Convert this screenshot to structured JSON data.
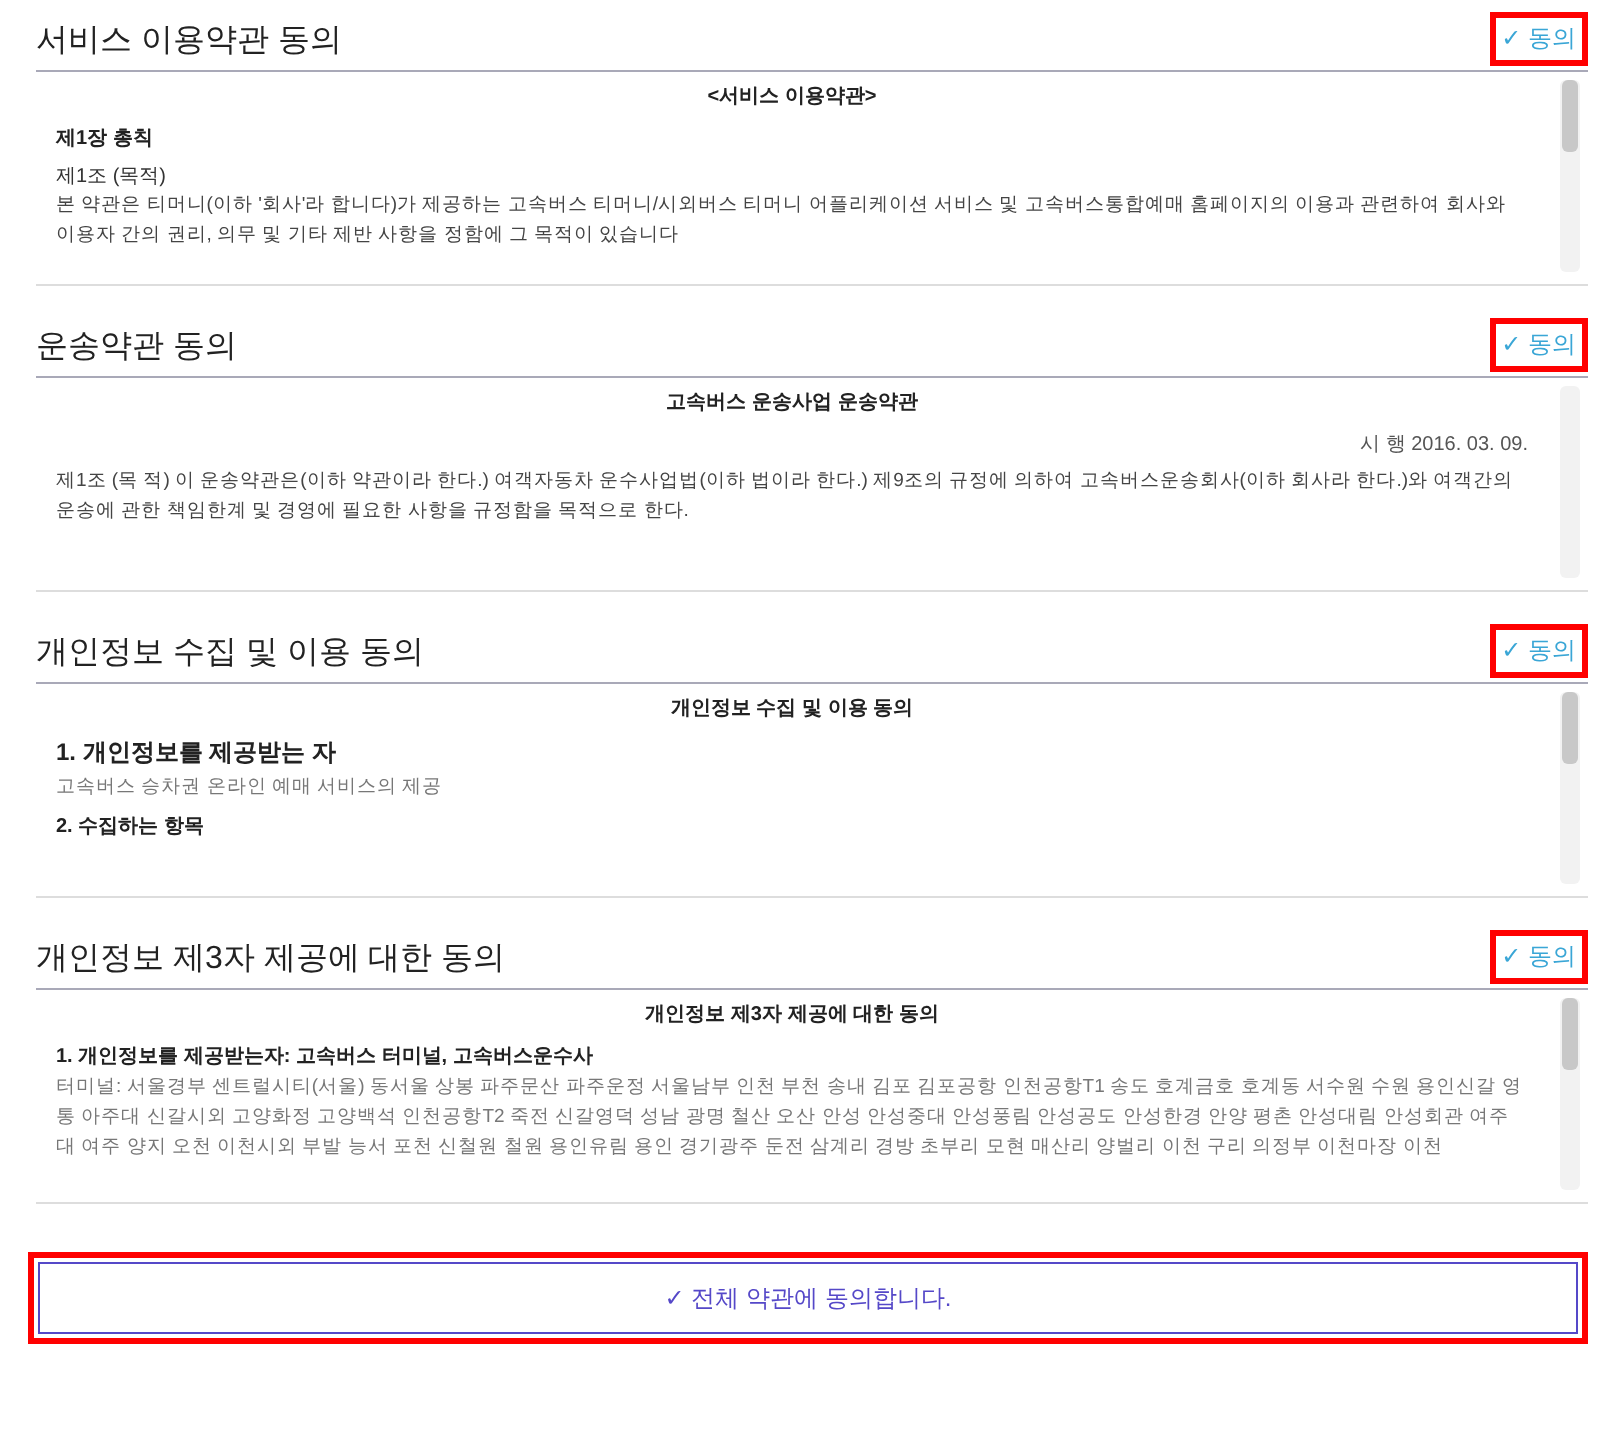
{
  "sections": [
    {
      "title": "서비스 이용약관 동의",
      "agree": {
        "label": "✓ 동의",
        "highlighted": true
      },
      "scroll_thumb": true,
      "content": [
        {
          "kind": "doc-title",
          "text": "<서비스 이용약관>"
        },
        {
          "kind": "chapter",
          "text": "제1장 총칙"
        },
        {
          "kind": "article",
          "text": "제1조 (목적)"
        },
        {
          "kind": "para",
          "text": "본 약관은 티머니(이하 '회사'라 합니다)가 제공하는 고속버스 티머니/시외버스 티머니 어플리케이션 서비스 및 고속버스통합예매 홈페이지의 이용과 관련하여 회사와 이용자 간의 권리, 의무 및 기타 제반 사항을 정함에 그 목적이 있습니다"
        }
      ]
    },
    {
      "title": "운송약관 동의",
      "agree": {
        "label": "✓ 동의",
        "highlighted": true
      },
      "scroll_thumb": false,
      "content": [
        {
          "kind": "doc-title",
          "text": "고속버스 운송사업 운송약관"
        },
        {
          "kind": "date",
          "text": "시 행 2016. 03. 09."
        },
        {
          "kind": "para",
          "text": "제1조 (목 적) 이 운송약관은(이하 약관이라 한다.) 여객자동차 운수사업법(이하 법이라 한다.) 제9조의 규정에 의하여 고속버스운송회사(이하 회사라 한다.)와 여객간의 운송에 관한 책임한계 및 경영에 필요한 사항을 규정함을 목적으로 한다."
        }
      ]
    },
    {
      "title": "개인정보 수집 및 이용 동의",
      "agree": {
        "label": "✓ 동의",
        "highlighted": true
      },
      "scroll_thumb": true,
      "content": [
        {
          "kind": "doc-title",
          "text": "개인정보 수집 및 이용 동의"
        },
        {
          "kind": "heading",
          "text": "1. 개인정보를 제공받는 자"
        },
        {
          "kind": "light",
          "text": "고속버스 승차권 온라인 예매 서비스의 제공"
        },
        {
          "kind": "article-bold",
          "text": "2. 수집하는 항목"
        }
      ]
    },
    {
      "title": "개인정보 제3자 제공에 대한 동의",
      "agree": {
        "label": "✓ 동의",
        "highlighted": true
      },
      "scroll_thumb": true,
      "content": [
        {
          "kind": "doc-title",
          "text": "개인정보 제3자 제공에 대한 동의"
        },
        {
          "kind": "article-bold",
          "text": "1. 개인정보를 제공받는자: 고속버스 터미널, 고속버스운수사"
        },
        {
          "kind": "light",
          "text": "터미널: 서울경부 센트럴시티(서울) 동서울 상봉 파주문산 파주운정 서울남부 인천 부천 송내 김포 김포공항 인천공항T1 송도 호계금호 호계동 서수원 수원 용인신갈 영통 아주대 신갈시외 고양화정 고양백석 인천공항T2 죽전 신갈영덕 성남 광명 철산 오산 안성 안성중대 안성풍림 안성공도 안성한경 안양 평촌 안성대림 안성회관 여주대 여주 양지 오천 이천시외 부발 능서 포천 신철원 철원 용인유림 용인 경기광주 둔전 삼계리 경방 초부리 모현 매산리 양벌리 이천 구리 의정부 이천마장 이천"
        }
      ]
    }
  ],
  "agree_all": {
    "label": "✓ 전체 약관에 동의합니다.",
    "highlighted": true
  }
}
